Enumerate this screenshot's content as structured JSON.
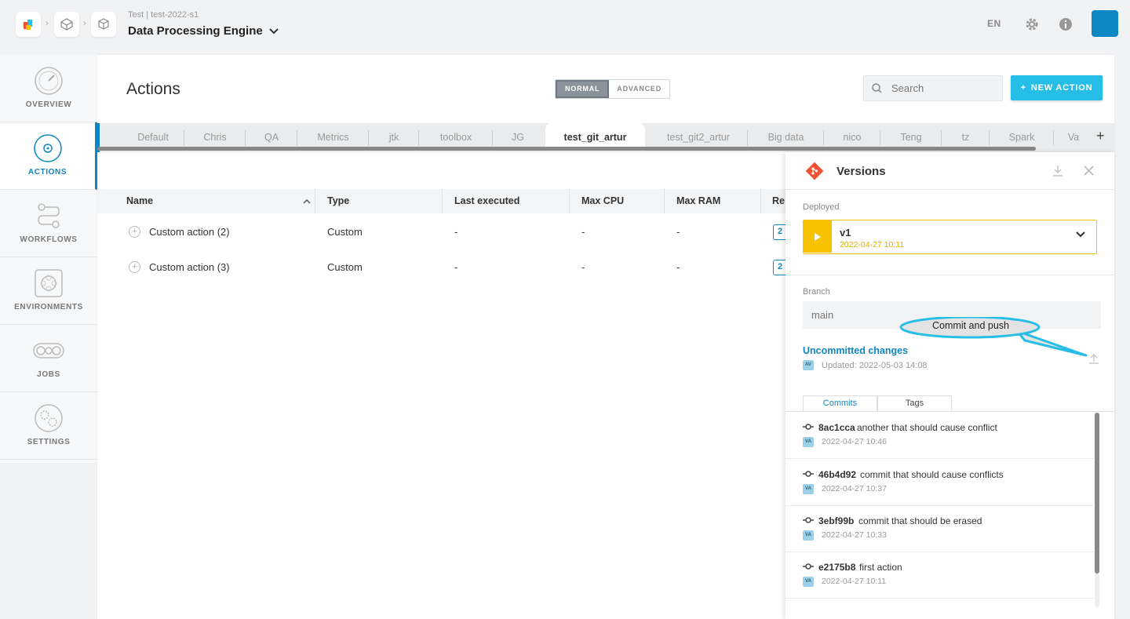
{
  "header": {
    "breadcrumb_sub": "Test | test-2022-s1",
    "project_title": "Data Processing Engine",
    "language": "EN"
  },
  "sidebar": {
    "items": [
      {
        "label": "OVERVIEW",
        "icon": "gauge-icon"
      },
      {
        "label": "ACTIONS",
        "icon": "actions-icon",
        "active": true
      },
      {
        "label": "WORKFLOWS",
        "icon": "workflow-icon"
      },
      {
        "label": "ENVIRONMENTS",
        "icon": "environments-icon"
      },
      {
        "label": "JOBS",
        "icon": "jobs-icon"
      },
      {
        "label": "SETTINGS",
        "icon": "settings-icon"
      }
    ]
  },
  "main": {
    "title": "Actions",
    "mode_normal": "NORMAL",
    "mode_advanced": "ADVANCED",
    "search_placeholder": "Search",
    "new_action_label": "NEW ACTION",
    "tabs": [
      "Default",
      "Chris",
      "QA",
      "Metrics",
      "jtk",
      "toolbox",
      "JG",
      "test_git_artur",
      "test_git2_artur",
      "Big data",
      "nico",
      "Teng",
      "tz",
      "Spark",
      "Va"
    ],
    "active_tab": "test_git_artur",
    "table": {
      "columns": [
        "Name",
        "Type",
        "Last executed",
        "Max CPU",
        "Max RAM",
        "Re:"
      ],
      "rows": [
        {
          "name": "Custom action (2)",
          "type": "Custom",
          "last_executed": "-",
          "max_cpu": "-",
          "max_ram": "-",
          "res": "2"
        },
        {
          "name": "Custom action (3)",
          "type": "Custom",
          "last_executed": "-",
          "max_cpu": "-",
          "max_ram": "-",
          "res": "2"
        }
      ]
    }
  },
  "versions": {
    "title": "Versions",
    "deployed_label": "Deployed",
    "deployed_version": "v1",
    "deployed_date": "2022-04-27 10:11",
    "branch_label": "Branch",
    "branch_value": "main",
    "uncommitted_label": "Uncommitted changes",
    "updated_avatar": "AV",
    "updated_text": "Updated: 2022-05-03 14:08",
    "tooltip": "Commit and push",
    "tab_commits": "Commits",
    "tab_tags": "Tags",
    "commits": [
      {
        "hash": "8ac1cca",
        "message": "another that should cause conflict",
        "avatar": "VA",
        "date": "2022-04-27 10:46"
      },
      {
        "hash": "46b4d92",
        "message": "commit that should cause conflicts",
        "avatar": "VA",
        "date": "2022-04-27 10:37"
      },
      {
        "hash": "3ebf99b",
        "message": "commit that should be erased",
        "avatar": "VA",
        "date": "2022-04-27 10:33"
      },
      {
        "hash": "e2175b8",
        "message": "first action",
        "avatar": "VA",
        "date": "2022-04-27 10:11"
      }
    ]
  },
  "colors": {
    "accent": "#0f87c4",
    "new_action": "#26bde6",
    "deployed": "#f7c200",
    "git": "#f05133"
  }
}
